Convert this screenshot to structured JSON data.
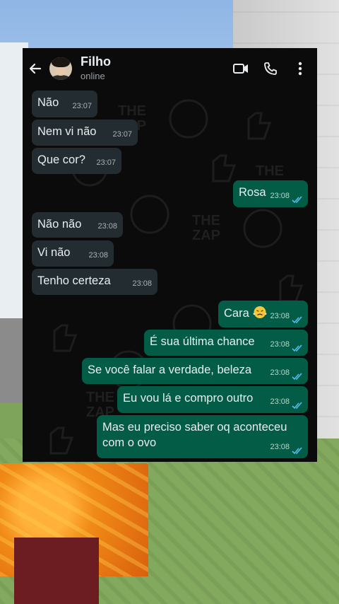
{
  "header": {
    "contact_name": "Filho",
    "status": "online",
    "back_icon": "back-arrow-icon",
    "actions": [
      "video-call-icon",
      "phone-icon",
      "more-options-icon"
    ]
  },
  "colors": {
    "chat_background": "#0b0b0b",
    "incoming_bubble": "#232d31",
    "outgoing_bubble": "#035c46",
    "read_ticks": "#53bdeb"
  },
  "watermark_text": [
    "THE",
    "ZAP"
  ],
  "messages": [
    {
      "direction": "in",
      "text": "Não",
      "time": "23:07"
    },
    {
      "direction": "in",
      "text": "Nem vi não",
      "time": "23:07"
    },
    {
      "direction": "in",
      "text": "Que cor?",
      "time": "23:07"
    },
    {
      "direction": "out",
      "text": "Rosa",
      "time": "23:08",
      "status": "read"
    },
    {
      "direction": "in",
      "text": "Não não",
      "time": "23:08"
    },
    {
      "direction": "in",
      "text": "Vi não",
      "time": "23:08"
    },
    {
      "direction": "in",
      "text": "Tenho certeza",
      "time": "23:08"
    },
    {
      "direction": "out",
      "text": "Cara",
      "emoji": "face-with-steam-emoji",
      "time": "23:08",
      "status": "read"
    },
    {
      "direction": "out",
      "text": "É sua última chance",
      "time": "23:08",
      "status": "read"
    },
    {
      "direction": "out",
      "text": "Se você falar a verdade, beleza",
      "time": "23:08",
      "status": "read"
    },
    {
      "direction": "out",
      "text": "Eu vou lá e compro outro",
      "time": "23:08",
      "status": "read"
    },
    {
      "direction": "out",
      "text": "Mas eu preciso saber oq aconteceu com o ovo",
      "time": "23:08",
      "status": "read"
    }
  ]
}
